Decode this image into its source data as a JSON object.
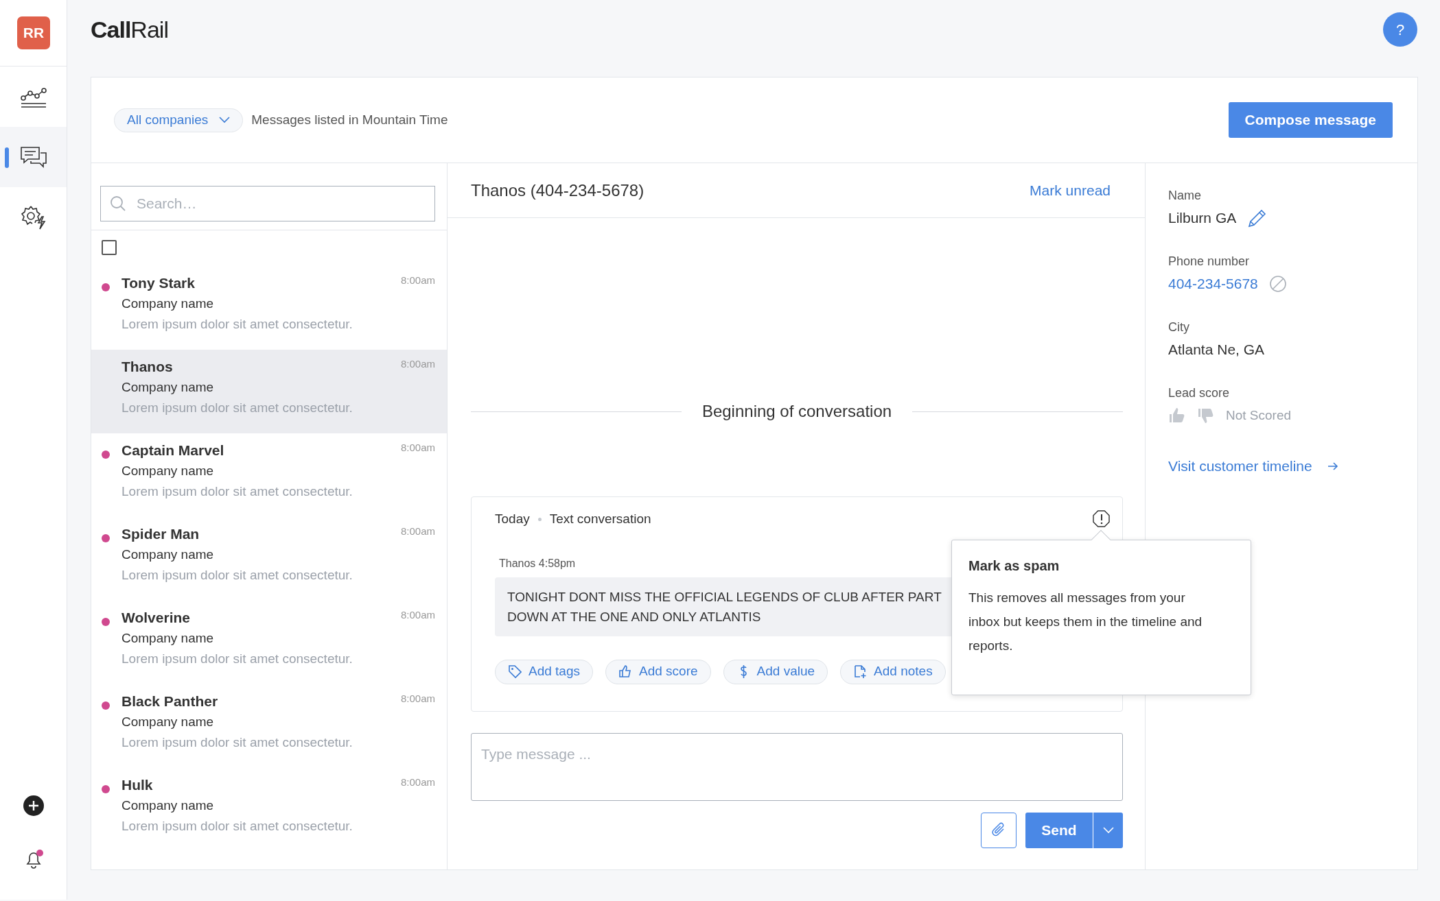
{
  "account": {
    "initials": "RR"
  },
  "logo": "**Call**Rail",
  "help": {
    "label": "?"
  },
  "nav": [
    {
      "kind": "chart",
      "selected": false
    },
    {
      "kind": "messages",
      "selected": true
    },
    {
      "kind": "settings",
      "selected": false
    }
  ],
  "notifications": {
    "unread": true
  },
  "toolbar": {
    "company_filter": "All companies",
    "timezone_note": "Messages listed in Mountain Time",
    "compose_button": "Compose message"
  },
  "search": {
    "placeholder": "Search…"
  },
  "select_all": {
    "checked": false
  },
  "conversations": [
    {
      "name": "Tony Stark",
      "company": "Company name",
      "preview": "Lorem ipsum dolor sit amet consectetur.",
      "time": "8:00am",
      "unread": true,
      "selected": false
    },
    {
      "name": "Thanos",
      "company": "Company name",
      "preview": "Lorem ipsum dolor sit amet consectetur.",
      "time": "8:00am",
      "unread": false,
      "selected": true
    },
    {
      "name": "Captain Marvel",
      "company": "Company name",
      "preview": "Lorem ipsum dolor sit amet consectetur.",
      "time": "8:00am",
      "unread": true,
      "selected": false
    },
    {
      "name": "Spider Man",
      "company": "Company name",
      "preview": "Lorem ipsum dolor sit amet consectetur.",
      "time": "8:00am",
      "unread": true,
      "selected": false
    },
    {
      "name": "Wolverine",
      "company": "Company name",
      "preview": "Lorem ipsum dolor sit amet consectetur.",
      "time": "8:00am",
      "unread": true,
      "selected": false
    },
    {
      "name": "Black Panther",
      "company": "Company name",
      "preview": "Lorem ipsum dolor sit amet consectetur.",
      "time": "8:00am",
      "unread": true,
      "selected": false
    },
    {
      "name": "Hulk",
      "company": "Company name",
      "preview": "Lorem ipsum dolor sit amet consectetur.",
      "time": "8:00am",
      "unread": true,
      "selected": false
    }
  ],
  "conversation": {
    "title": "Thanos (404-234-5678)",
    "mark_unread": "Mark unread",
    "divider_label": "Beginning of conversation",
    "day": "Today",
    "type": "Text conversation",
    "messages": [
      {
        "sender_time": "Thanos 4:58pm",
        "lines": [
          "TONIGHT DONT MISS THE OFFICIAL LEGENDS OF CLUB AFTER PART",
          "DOWN AT THE ONE AND ONLY ATLANTIS"
        ]
      }
    ],
    "actions": [
      {
        "kind": "tag",
        "label": "Add tags"
      },
      {
        "kind": "score",
        "label": "Add score"
      },
      {
        "kind": "value",
        "label": "Add value"
      },
      {
        "kind": "notes",
        "label": "Add notes"
      }
    ]
  },
  "tooltip": {
    "title": "Mark as spam",
    "body": "This removes all messages from your inbox but keeps them in the timeline and reports."
  },
  "composer": {
    "placeholder": "Type message ...",
    "send": "Send"
  },
  "contact": {
    "fields": [
      {
        "label": "Name",
        "value": "Lilburn GA",
        "kind": "editable"
      },
      {
        "label": "Phone number",
        "value": "404-234-5678",
        "kind": "phone"
      },
      {
        "label": "City",
        "value": "Atlanta Ne, GA",
        "kind": "plain"
      }
    ],
    "lead_score": {
      "label": "Lead score",
      "status": "Not Scored"
    },
    "timeline_link": "Visit customer timeline"
  }
}
